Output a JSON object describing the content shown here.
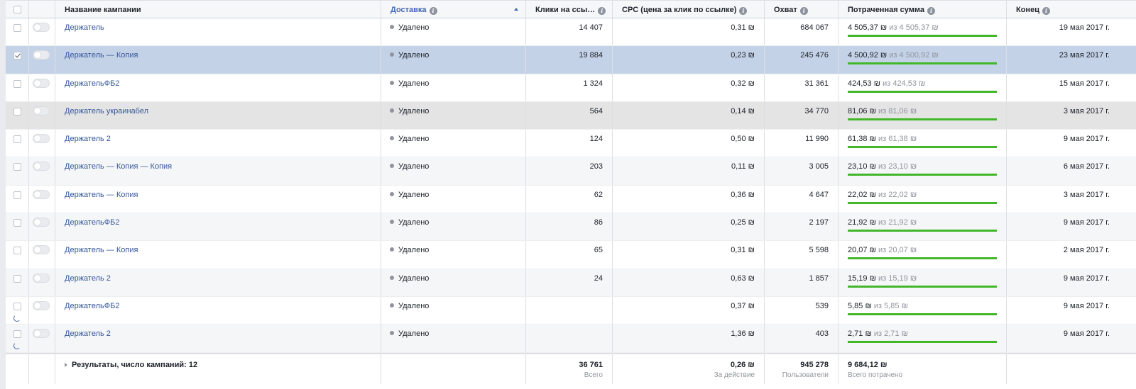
{
  "header": {
    "name": "Название кампании",
    "delivery": "Доставка",
    "clicks": "Клики на ссы…",
    "cpc": "CPC (цена за клик по ссылке)",
    "reach": "Охват",
    "spent": "Потраченная сумма",
    "end": "Конец"
  },
  "rows": [
    {
      "name": "Держатель",
      "delivery": "Удалено",
      "clicks": "14 407",
      "cpc": "0,31 ₪",
      "reach": "684 067",
      "spent": "4 505,37 ₪",
      "spent_of": "из 4 505,37 ₪",
      "end": "19 мая 2017 г.",
      "style": "",
      "checked": false
    },
    {
      "name": "Держатель — Копия",
      "delivery": "Удалено",
      "clicks": "19 884",
      "cpc": "0,23 ₪",
      "reach": "245 476",
      "spent": "4 500,92 ₪",
      "spent_of": "из 4 500,92 ₪",
      "end": "23 мая 2017 г.",
      "style": "sel",
      "checked": true
    },
    {
      "name": "ДержательФБ2",
      "delivery": "Удалено",
      "clicks": "1 324",
      "cpc": "0,32 ₪",
      "reach": "31 361",
      "spent": "424,53 ₪",
      "spent_of": "из 424,53 ₪",
      "end": "15 мая 2017 г.",
      "style": "",
      "checked": false
    },
    {
      "name": "Держатель украинабел",
      "delivery": "Удалено",
      "clicks": "564",
      "cpc": "0,14 ₪",
      "reach": "34 770",
      "spent": "81,06 ₪",
      "spent_of": "из 81,06 ₪",
      "end": "3 мая 2017 г.",
      "style": "hov",
      "checked": false
    },
    {
      "name": "Держатель 2",
      "delivery": "Удалено",
      "clicks": "124",
      "cpc": "0,50 ₪",
      "reach": "11 990",
      "spent": "61,38 ₪",
      "spent_of": "из 61,38 ₪",
      "end": "9 мая 2017 г.",
      "style": "",
      "checked": false
    },
    {
      "name": "Держатель — Копия — Копия",
      "delivery": "Удалено",
      "clicks": "203",
      "cpc": "0,11 ₪",
      "reach": "3 005",
      "spent": "23,10 ₪",
      "spent_of": "из 23,10 ₪",
      "end": "6 мая 2017 г.",
      "style": "alt",
      "checked": false
    },
    {
      "name": "Держатель — Копия",
      "delivery": "Удалено",
      "clicks": "62",
      "cpc": "0,36 ₪",
      "reach": "4 647",
      "spent": "22,02 ₪",
      "spent_of": "из 22,02 ₪",
      "end": "3 мая 2017 г.",
      "style": "",
      "checked": false
    },
    {
      "name": "ДержательФБ2",
      "delivery": "Удалено",
      "clicks": "86",
      "cpc": "0,25 ₪",
      "reach": "2 197",
      "spent": "21,92 ₪",
      "spent_of": "из 21,92 ₪",
      "end": "9 мая 2017 г.",
      "style": "alt",
      "checked": false
    },
    {
      "name": "Держатель — Копия",
      "delivery": "Удалено",
      "clicks": "65",
      "cpc": "0,31 ₪",
      "reach": "5 598",
      "spent": "20,07 ₪",
      "spent_of": "из 20,07 ₪",
      "end": "2 мая 2017 г.",
      "style": "",
      "checked": false
    },
    {
      "name": "Держатель 2",
      "delivery": "Удалено",
      "clicks": "24",
      "cpc": "0,63 ₪",
      "reach": "1 857",
      "spent": "15,19 ₪",
      "spent_of": "из 15,19 ₪",
      "end": "9 мая 2017 г.",
      "style": "alt",
      "checked": false
    },
    {
      "name": "ДержательФБ2",
      "delivery": "Удалено",
      "clicks": "",
      "cpc": "0,37 ₪",
      "reach": "539",
      "spent": "5,85 ₪",
      "spent_of": "из 5,85 ₪",
      "end": "9 мая 2017 г.",
      "style": "",
      "checked": false,
      "loading": true
    },
    {
      "name": "Держатель 2",
      "delivery": "Удалено",
      "clicks": "",
      "cpc": "1,36 ₪",
      "reach": "403",
      "spent": "2,71 ₪",
      "spent_of": "из 2,71 ₪",
      "end": "9 мая 2017 г.",
      "style": "alt",
      "checked": false,
      "loading": true
    }
  ],
  "footer": {
    "results": "Результаты, число кампаний: 12",
    "clicks": "36 761",
    "clicks_sub": "Всего",
    "cpc": "0,26 ₪",
    "cpc_sub": "За действие",
    "reach": "945 278",
    "reach_sub": "Пользователи",
    "spent": "9 684,12 ₪",
    "spent_sub": "Всего потрачено"
  },
  "colors": {
    "link": "#365899",
    "selected_row": "#c4d2e7",
    "progress": "#42b72a"
  }
}
